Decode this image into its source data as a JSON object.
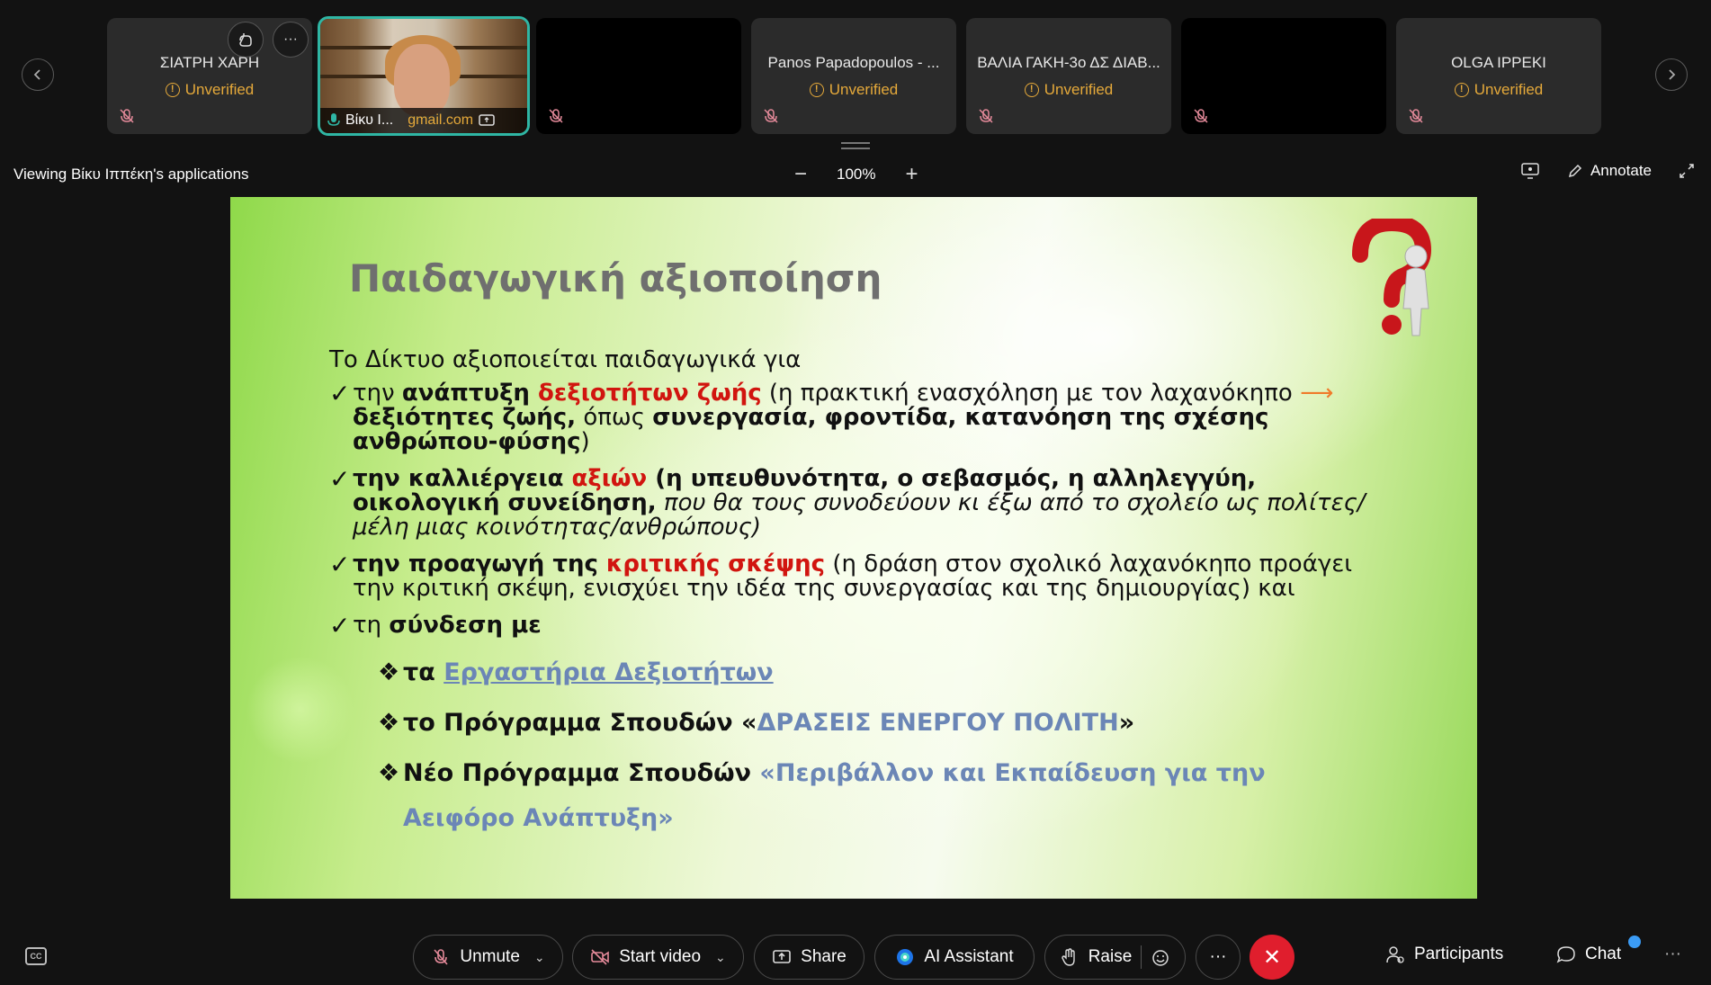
{
  "participants": {
    "tiles": [
      {
        "name": "ΣΙΑΤΡΗ ΧΑΡΗ",
        "status": "Unverified"
      },
      {
        "name": "Βίκυ Ι...",
        "email": "gmail.com",
        "is_self_video": true
      },
      {
        "name": ""
      },
      {
        "name": "Panos Papadopoulos  - ...",
        "status": "Unverified"
      },
      {
        "name": "ΒΑΛΙΑ ΓΑΚΗ-3ο ΔΣ ΔΙΑΒ...",
        "status": "Unverified"
      },
      {
        "name": ""
      },
      {
        "name": "OLGA IPPEKI",
        "status": "Unverified"
      }
    ],
    "more_label": "···"
  },
  "viewing": {
    "label": "Viewing Βίκυ Ιππέκη's applications",
    "zoom": "100%",
    "annotate_label": "Annotate"
  },
  "slide": {
    "title": "Παιδαγωγική αξιοποίηση",
    "intro": "Το Δίκτυο αξιοποιείται παιδαγωγικά για",
    "check": "✓",
    "item1": {
      "a": "την ",
      "b": "ανάπτυξη ",
      "red": "δεξιοτήτων ζωής",
      "c": " (η πρακτική ενασχόληση με τον λαχανόκηπο ",
      "arrow": "⟶",
      "d": "δεξιότητες ζωής,",
      "e": " όπως ",
      "f": "συνεργασία, φροντίδα, κατανόηση της σχέσης ανθρώπου-φύσης",
      "g": ")"
    },
    "item2": {
      "a": "την καλλιέργεια ",
      "red": "αξιών",
      "b": " (η υπευθυνότητα, ο σεβασμός, η αλληλεγγύη, οικολογική συνείδηση,",
      "c": " που θα τους συνοδεύουν κι έξω από το σχολείο ως πολίτες/μέλη μιας κοινότητας/ανθρώπους)"
    },
    "item3": {
      "a": "την προαγωγή της ",
      "red": "κριτικής σκέψης",
      "b": " (η δράση στον σχολικό λαχανόκηπο προάγει την κριτική σκέψη, ενισχύει την ιδέα της συνεργασίας και της δημιουργίας) και"
    },
    "item4": {
      "a": "τη ",
      "b": "σύνδεση με"
    },
    "diamond": "❖",
    "sub1": {
      "a": "τα ",
      "link": "Εργαστήρια Δεξιοτήτων"
    },
    "sub2": {
      "a": "το Πρόγραμμα Σπουδών «",
      "blue": "ΔΡΑΣΕΙΣ ΕΝΕΡΓΟΥ ΠΟΛΙΤΗ",
      "b": "»"
    },
    "sub3": {
      "a": "Νέο Πρόγραμμα Σπουδών ",
      "blue": "«Περιβάλλον και Εκπαίδευση για την Αειφόρο Ανάπτυξη»"
    }
  },
  "controls": {
    "cc_label": "CC",
    "unmute": "Unmute",
    "start_video": "Start video",
    "share": "Share",
    "ai_assistant": "AI Assistant",
    "raise": "Raise",
    "more": "···",
    "end": "✕",
    "participants": "Participants",
    "chat": "Chat",
    "overflow": "···"
  },
  "colors": {
    "accent_teal": "#2fb6a4",
    "unverified": "#e5a93a",
    "end_call": "#e01e2d",
    "chat_badge": "#3b9cf6"
  }
}
